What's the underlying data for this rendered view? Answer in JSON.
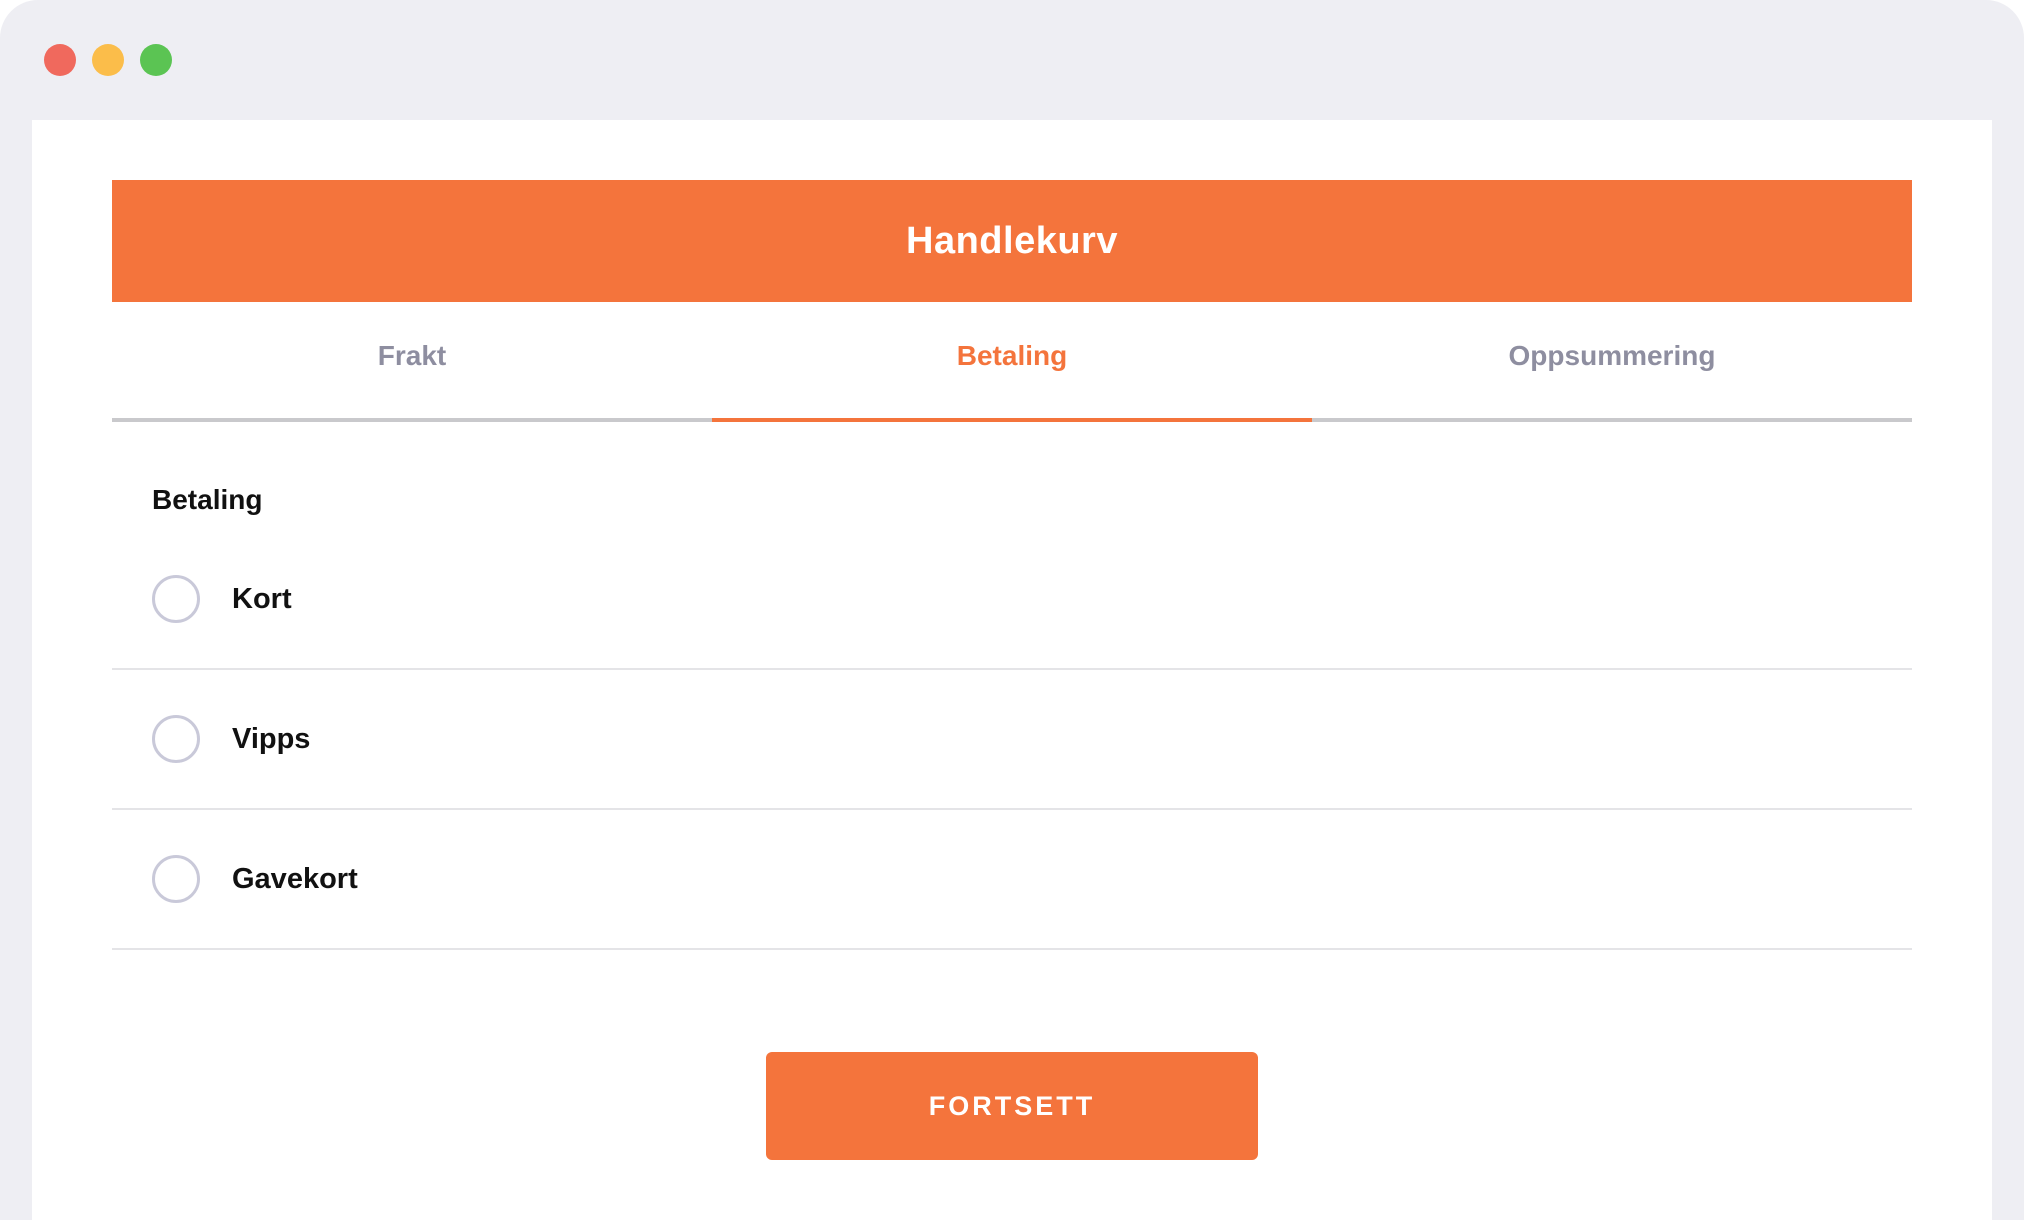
{
  "window": {
    "controls": [
      "close",
      "minimize",
      "zoom"
    ]
  },
  "header": {
    "title": "Handlekurv"
  },
  "tabs": [
    {
      "label": "Frakt",
      "active": false
    },
    {
      "label": "Betaling",
      "active": true
    },
    {
      "label": "Oppsummering",
      "active": false
    }
  ],
  "payment": {
    "section_title": "Betaling",
    "options": [
      {
        "label": "Kort",
        "selected": false
      },
      {
        "label": "Vipps",
        "selected": false
      },
      {
        "label": "Gavekort",
        "selected": false
      }
    ]
  },
  "actions": {
    "continue_label": "FORTSETT"
  },
  "colors": {
    "accent": "#f4743c",
    "tab_inactive": "#8e8ea0",
    "window_chrome": "#eeeef3",
    "close": "#f0695d",
    "minimize": "#fbbd4a",
    "zoom": "#5bc453"
  }
}
